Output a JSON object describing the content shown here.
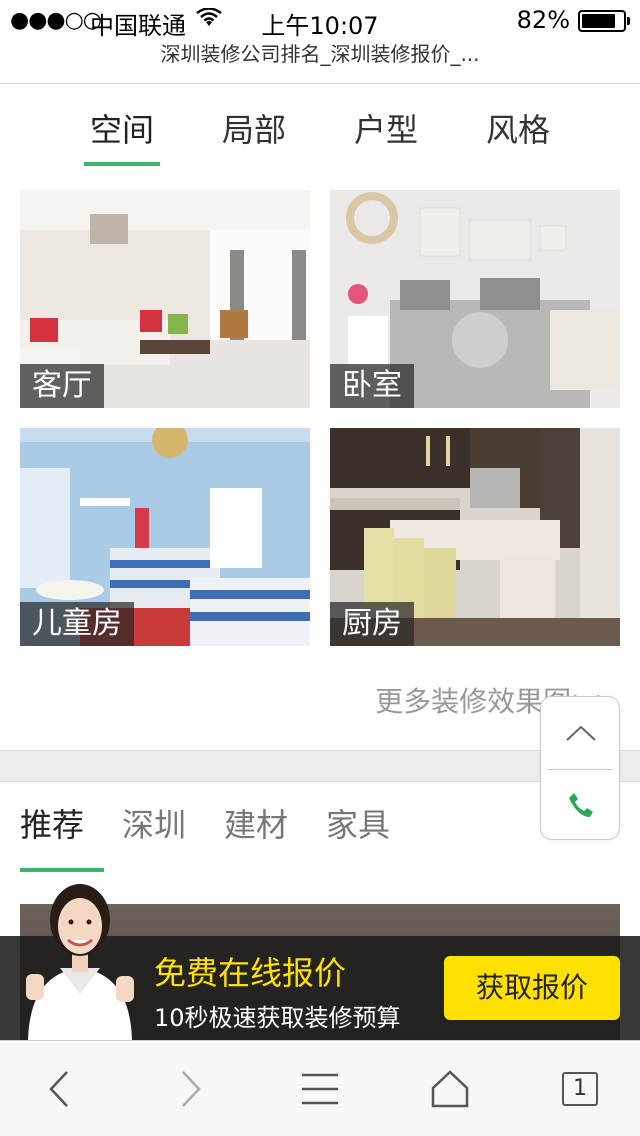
{
  "status_bar": {
    "carrier": "中国联通",
    "time": "上午10:07",
    "battery": "82%",
    "battery_level": 0.82
  },
  "page": {
    "title": "深圳装修公司排名_深圳装修报价_..."
  },
  "category_tabs": [
    {
      "label": "空间",
      "active": true
    },
    {
      "label": "局部",
      "active": false
    },
    {
      "label": "户型",
      "active": false
    },
    {
      "label": "风格",
      "active": false
    }
  ],
  "rooms": [
    {
      "label": "客厅"
    },
    {
      "label": "卧室"
    },
    {
      "label": "儿童房"
    },
    {
      "label": "厨房"
    }
  ],
  "more_link": "更多装修效果图>>",
  "news_tabs": [
    {
      "label": "推荐",
      "active": true
    },
    {
      "label": "深圳",
      "active": false
    },
    {
      "label": "建材",
      "active": false
    },
    {
      "label": "家具",
      "active": false
    }
  ],
  "quote_banner": {
    "title": "免费在线报价",
    "subtitle": "10秒极速获取装修预算",
    "button": "获取报价"
  },
  "browser_bar": {
    "tab_count": "1"
  },
  "colors": {
    "accent": "#3db56a",
    "cta": "#ffe100",
    "banner_bg": "#1c1c1c"
  }
}
